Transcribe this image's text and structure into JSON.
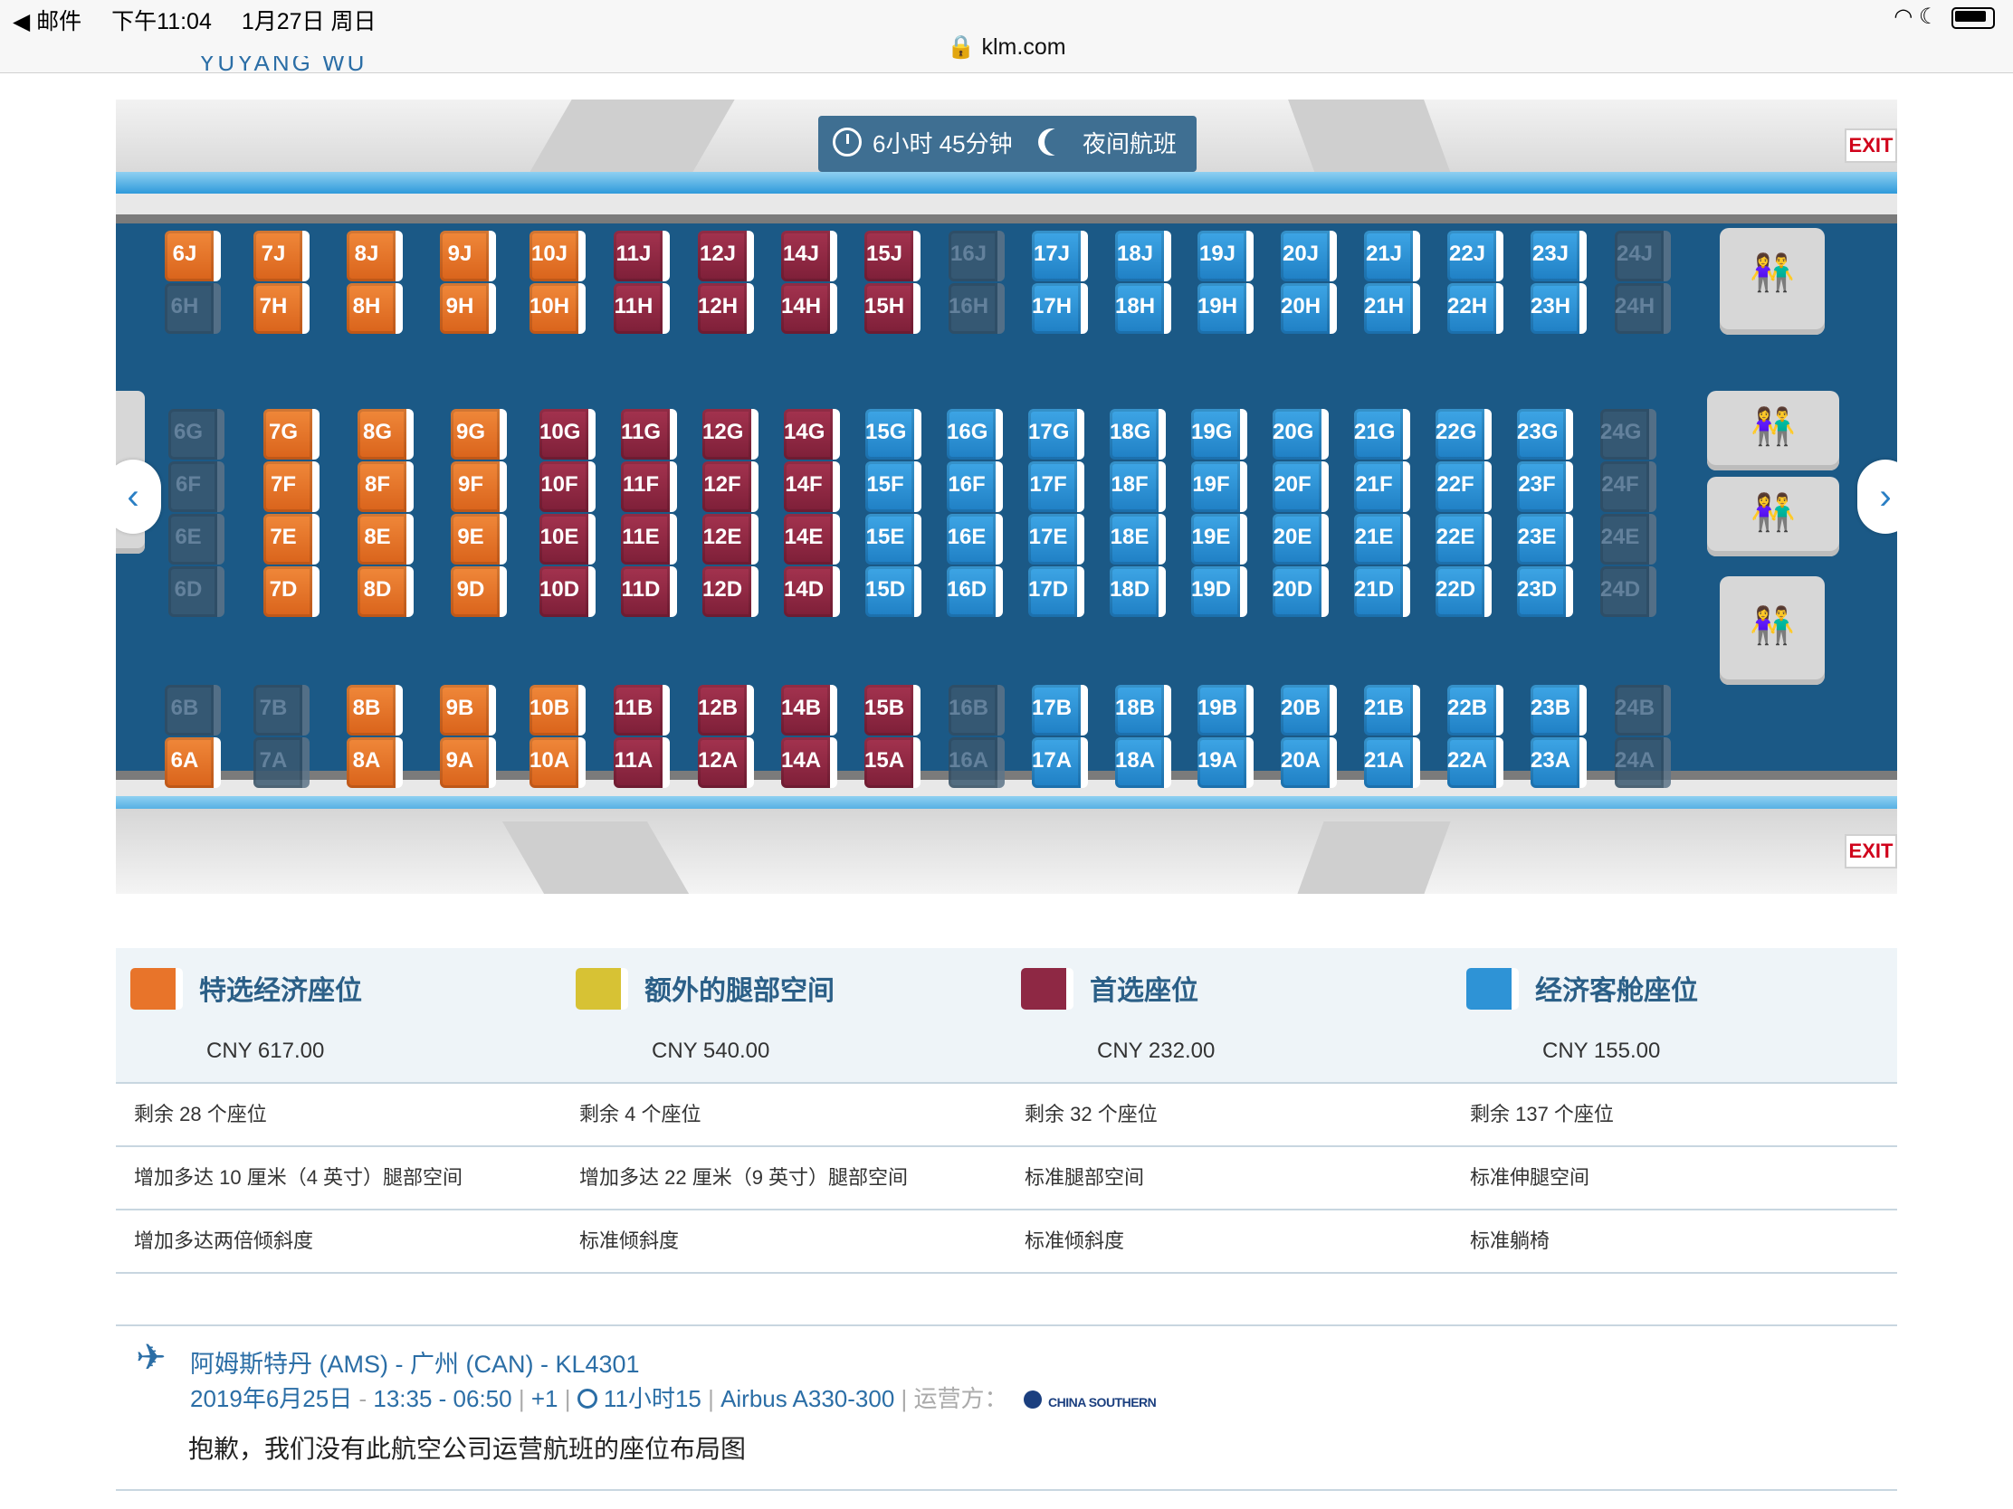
{
  "status_bar": {
    "back_app": "◀ 邮件",
    "time": "下午11:04",
    "date": "1月27日 周日",
    "url": "klm.com"
  },
  "passenger_name_partial": "YUYANG WU",
  "flight_info": {
    "duration": "6小时 45分钟",
    "night_flight": "夜间航班",
    "exit_label": "EXIT"
  },
  "colors": {
    "orange": "#e8742a",
    "red": "#8e2844",
    "blue": "#2e93d6",
    "cabin": "#1b5986",
    "grey": "#3a5870"
  },
  "seat_rows": [
    {
      "row": "top",
      "seats": [
        {
          "label": "6J",
          "cls": "orange"
        },
        {
          "label": "7J",
          "cls": "orange"
        },
        {
          "label": "8J",
          "cls": "orange"
        },
        {
          "label": "9J",
          "cls": "orange"
        },
        {
          "label": "10J",
          "cls": "orange"
        },
        {
          "label": "11J",
          "cls": "red"
        },
        {
          "label": "12J",
          "cls": "red"
        },
        {
          "label": "14J",
          "cls": "red"
        },
        {
          "label": "15J",
          "cls": "red"
        },
        {
          "label": "16J",
          "cls": "grey"
        },
        {
          "label": "17J",
          "cls": "blue"
        },
        {
          "label": "18J",
          "cls": "blue"
        },
        {
          "label": "19J",
          "cls": "blue"
        },
        {
          "label": "20J",
          "cls": "blue"
        },
        {
          "label": "21J",
          "cls": "blue"
        },
        {
          "label": "22J",
          "cls": "blue"
        },
        {
          "label": "23J",
          "cls": "blue"
        },
        {
          "label": "24J",
          "cls": "grey"
        }
      ]
    },
    {
      "row": "top2",
      "seats": [
        {
          "label": "6H",
          "cls": "grey"
        },
        {
          "label": "7H",
          "cls": "orange"
        },
        {
          "label": "8H",
          "cls": "orange"
        },
        {
          "label": "9H",
          "cls": "orange"
        },
        {
          "label": "10H",
          "cls": "orange"
        },
        {
          "label": "11H",
          "cls": "red"
        },
        {
          "label": "12H",
          "cls": "red"
        },
        {
          "label": "14H",
          "cls": "red"
        },
        {
          "label": "15H",
          "cls": "red"
        },
        {
          "label": "16H",
          "cls": "grey"
        },
        {
          "label": "17H",
          "cls": "blue"
        },
        {
          "label": "18H",
          "cls": "blue"
        },
        {
          "label": "19H",
          "cls": "blue"
        },
        {
          "label": "20H",
          "cls": "blue"
        },
        {
          "label": "21H",
          "cls": "blue"
        },
        {
          "label": "22H",
          "cls": "blue"
        },
        {
          "label": "23H",
          "cls": "blue"
        },
        {
          "label": "24H",
          "cls": "grey"
        }
      ]
    },
    {
      "row": "mid1",
      "seats": [
        {
          "label": "6G",
          "cls": "grey"
        },
        {
          "label": "7G",
          "cls": "orange"
        },
        {
          "label": "8G",
          "cls": "orange"
        },
        {
          "label": "9G",
          "cls": "orange"
        },
        {
          "label": "10G",
          "cls": "red"
        },
        {
          "label": "11G",
          "cls": "red"
        },
        {
          "label": "12G",
          "cls": "red"
        },
        {
          "label": "14G",
          "cls": "red"
        },
        {
          "label": "15G",
          "cls": "blue"
        },
        {
          "label": "16G",
          "cls": "blue"
        },
        {
          "label": "17G",
          "cls": "blue"
        },
        {
          "label": "18G",
          "cls": "blue"
        },
        {
          "label": "19G",
          "cls": "blue"
        },
        {
          "label": "20G",
          "cls": "blue"
        },
        {
          "label": "21G",
          "cls": "blue"
        },
        {
          "label": "22G",
          "cls": "blue"
        },
        {
          "label": "23G",
          "cls": "blue"
        },
        {
          "label": "24G",
          "cls": "grey"
        }
      ]
    },
    {
      "row": "mid2",
      "seats": [
        {
          "label": "6F",
          "cls": "grey"
        },
        {
          "label": "7F",
          "cls": "orange"
        },
        {
          "label": "8F",
          "cls": "orange"
        },
        {
          "label": "9F",
          "cls": "orange"
        },
        {
          "label": "10F",
          "cls": "red"
        },
        {
          "label": "11F",
          "cls": "red"
        },
        {
          "label": "12F",
          "cls": "red"
        },
        {
          "label": "14F",
          "cls": "red"
        },
        {
          "label": "15F",
          "cls": "blue"
        },
        {
          "label": "16F",
          "cls": "blue"
        },
        {
          "label": "17F",
          "cls": "blue"
        },
        {
          "label": "18F",
          "cls": "blue"
        },
        {
          "label": "19F",
          "cls": "blue"
        },
        {
          "label": "20F",
          "cls": "blue"
        },
        {
          "label": "21F",
          "cls": "blue"
        },
        {
          "label": "22F",
          "cls": "blue"
        },
        {
          "label": "23F",
          "cls": "blue"
        },
        {
          "label": "24F",
          "cls": "grey"
        }
      ]
    },
    {
      "row": "mid3",
      "seats": [
        {
          "label": "6E",
          "cls": "grey"
        },
        {
          "label": "7E",
          "cls": "orange"
        },
        {
          "label": "8E",
          "cls": "orange"
        },
        {
          "label": "9E",
          "cls": "orange"
        },
        {
          "label": "10E",
          "cls": "red"
        },
        {
          "label": "11E",
          "cls": "red"
        },
        {
          "label": "12E",
          "cls": "red"
        },
        {
          "label": "14E",
          "cls": "red"
        },
        {
          "label": "15E",
          "cls": "blue"
        },
        {
          "label": "16E",
          "cls": "blue"
        },
        {
          "label": "17E",
          "cls": "blue"
        },
        {
          "label": "18E",
          "cls": "blue"
        },
        {
          "label": "19E",
          "cls": "blue"
        },
        {
          "label": "20E",
          "cls": "blue"
        },
        {
          "label": "21E",
          "cls": "blue"
        },
        {
          "label": "22E",
          "cls": "blue"
        },
        {
          "label": "23E",
          "cls": "blue"
        },
        {
          "label": "24E",
          "cls": "grey"
        }
      ]
    },
    {
      "row": "mid4",
      "seats": [
        {
          "label": "6D",
          "cls": "grey"
        },
        {
          "label": "7D",
          "cls": "orange"
        },
        {
          "label": "8D",
          "cls": "orange"
        },
        {
          "label": "9D",
          "cls": "orange"
        },
        {
          "label": "10D",
          "cls": "red"
        },
        {
          "label": "11D",
          "cls": "red"
        },
        {
          "label": "12D",
          "cls": "red"
        },
        {
          "label": "14D",
          "cls": "red"
        },
        {
          "label": "15D",
          "cls": "blue"
        },
        {
          "label": "16D",
          "cls": "blue"
        },
        {
          "label": "17D",
          "cls": "blue"
        },
        {
          "label": "18D",
          "cls": "blue"
        },
        {
          "label": "19D",
          "cls": "blue"
        },
        {
          "label": "20D",
          "cls": "blue"
        },
        {
          "label": "21D",
          "cls": "blue"
        },
        {
          "label": "22D",
          "cls": "blue"
        },
        {
          "label": "23D",
          "cls": "blue"
        },
        {
          "label": "24D",
          "cls": "grey"
        }
      ]
    },
    {
      "row": "bot1",
      "seats": [
        {
          "label": "6B",
          "cls": "grey"
        },
        {
          "label": "7B",
          "cls": "grey"
        },
        {
          "label": "8B",
          "cls": "orange"
        },
        {
          "label": "9B",
          "cls": "orange"
        },
        {
          "label": "10B",
          "cls": "orange"
        },
        {
          "label": "11B",
          "cls": "red"
        },
        {
          "label": "12B",
          "cls": "red"
        },
        {
          "label": "14B",
          "cls": "red"
        },
        {
          "label": "15B",
          "cls": "red"
        },
        {
          "label": "16B",
          "cls": "grey"
        },
        {
          "label": "17B",
          "cls": "blue"
        },
        {
          "label": "18B",
          "cls": "blue"
        },
        {
          "label": "19B",
          "cls": "blue"
        },
        {
          "label": "20B",
          "cls": "blue"
        },
        {
          "label": "21B",
          "cls": "blue"
        },
        {
          "label": "22B",
          "cls": "blue"
        },
        {
          "label": "23B",
          "cls": "blue"
        },
        {
          "label": "24B",
          "cls": "grey"
        }
      ]
    },
    {
      "row": "bot2",
      "seats": [
        {
          "label": "6A",
          "cls": "orange"
        },
        {
          "label": "7A",
          "cls": "grey"
        },
        {
          "label": "8A",
          "cls": "orange"
        },
        {
          "label": "9A",
          "cls": "orange"
        },
        {
          "label": "10A",
          "cls": "orange"
        },
        {
          "label": "11A",
          "cls": "red"
        },
        {
          "label": "12A",
          "cls": "red"
        },
        {
          "label": "14A",
          "cls": "red"
        },
        {
          "label": "15A",
          "cls": "red"
        },
        {
          "label": "16A",
          "cls": "grey"
        },
        {
          "label": "17A",
          "cls": "blue"
        },
        {
          "label": "18A",
          "cls": "blue"
        },
        {
          "label": "19A",
          "cls": "blue"
        },
        {
          "label": "20A",
          "cls": "blue"
        },
        {
          "label": "21A",
          "cls": "blue"
        },
        {
          "label": "22A",
          "cls": "blue"
        },
        {
          "label": "23A",
          "cls": "blue"
        },
        {
          "label": "24A",
          "cls": "grey"
        }
      ]
    }
  ],
  "legend": [
    {
      "title": "特选经济座位",
      "price": "CNY 617.00",
      "remaining": "剩余 28 个座位",
      "legroom": "增加多达 10 厘米（4 英寸）腿部空间",
      "recline": "增加多达两倍倾斜度",
      "color": "orange"
    },
    {
      "title": "额外的腿部空间",
      "price": "CNY 540.00",
      "remaining": "剩余 4 个座位",
      "legroom": "增加多达 22 厘米（9 英寸）腿部空间",
      "recline": "标准倾斜度",
      "color": "yellow"
    },
    {
      "title": "首选座位",
      "price": "CNY 232.00",
      "remaining": "剩余 32 个座位",
      "legroom": "标准腿部空间",
      "recline": "标准倾斜度",
      "color": "red"
    },
    {
      "title": "经济客舱座位",
      "price": "CNY 155.00",
      "remaining": "剩余 137 个座位",
      "legroom": "标准伸腿空间",
      "recline": "标准躺椅",
      "color": "blue"
    }
  ],
  "next_flight": {
    "route": "阿姆斯特丹 (AMS) - 广州 (CAN) - KL4301",
    "date": "2019年6月25日",
    "times": "13:35 - 06:50",
    "day_offset": "+1",
    "duration": "11小时15",
    "aircraft": "Airbus A330-300",
    "operator_label": "运营方：",
    "operator_logo_text": "CHINA SOUTHERN",
    "message": "抱歉，我们没有此航空公司运营航班的座位布局图"
  }
}
